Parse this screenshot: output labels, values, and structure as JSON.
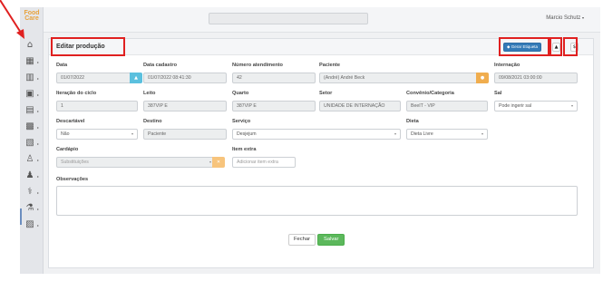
{
  "app": {
    "logo_line1": "Food",
    "logo_line2": "Care"
  },
  "topbar": {
    "user_name": "Marcio Schutz",
    "user_caret": "▾"
  },
  "sidebar": {
    "items": [
      {
        "icon": "home-icon",
        "glyph": "⌂"
      },
      {
        "icon": "grid-icon",
        "glyph": "▦"
      },
      {
        "icon": "building-icon",
        "glyph": "▥"
      },
      {
        "icon": "calendar-icon",
        "glyph": "▣"
      },
      {
        "icon": "document-icon",
        "glyph": "▤"
      },
      {
        "icon": "hospital-icon",
        "glyph": "▩"
      },
      {
        "icon": "files-icon",
        "glyph": "▧"
      },
      {
        "icon": "users-icon",
        "glyph": "♙"
      },
      {
        "icon": "group-icon",
        "glyph": "♟"
      },
      {
        "icon": "dna-icon",
        "glyph": "⚕"
      },
      {
        "icon": "flask-icon",
        "glyph": "⚗"
      },
      {
        "icon": "machine-icon",
        "glyph": "▨"
      }
    ]
  },
  "panel": {
    "title": "Editar produção",
    "etiqueta_button": "Gerar Etiqueta",
    "warning_button": "▲",
    "dollar_button": "$"
  },
  "form": {
    "data": {
      "label": "Data",
      "value": "01/07/2022"
    },
    "data_cadastro": {
      "label": "Data cadastro",
      "value": "01/07/2022 08:41:30"
    },
    "numero_atendimento": {
      "label": "Número atendimento",
      "value": "42"
    },
    "paciente": {
      "label": "Paciente",
      "value": "(André) André Beck"
    },
    "internacao": {
      "label": "Internação",
      "value": "09/08/2021 03:00:00"
    },
    "iteracao_ciclo": {
      "label": "Iteração do ciclo",
      "value": "1"
    },
    "leito": {
      "label": "Leito",
      "value": "387VIP E"
    },
    "quarto": {
      "label": "Quarto",
      "value": "387VIP E"
    },
    "setor": {
      "label": "Setor",
      "value": "UNIDADE DE INTERNAÇÃO"
    },
    "convenio": {
      "label": "Convênio/Categoria",
      "value": "BeeIT - VIP"
    },
    "sal": {
      "label": "Sal",
      "value": "Pode ingerir sal"
    },
    "descartavel": {
      "label": "Descartável",
      "value": "Não"
    },
    "destino": {
      "label": "Destino",
      "value": "Paciente"
    },
    "servico": {
      "label": "Serviço",
      "value": "Desjejum"
    },
    "dieta": {
      "label": "Dieta",
      "value": "Dieta Livre"
    },
    "cardapio": {
      "label": "Cardápio",
      "placeholder": "Substituições"
    },
    "item_extra": {
      "label": "Item extra",
      "placeholder": "Adicionar item extra"
    },
    "observacoes": {
      "label": "Observações",
      "value": ""
    }
  },
  "actions": {
    "fechar": "Fechar",
    "salvar": "Salvar"
  },
  "colors": {
    "primary": "#337ab7",
    "success": "#5cb85c",
    "info": "#5bc0de",
    "warning": "#f0ad4e",
    "annotation": "#e02020"
  }
}
